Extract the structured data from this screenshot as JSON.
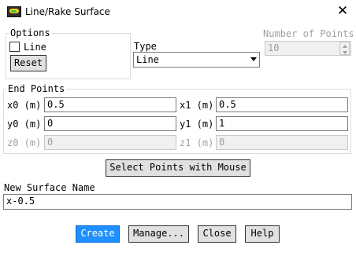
{
  "window": {
    "title": "Line/Rake Surface",
    "close_symbol": "✕"
  },
  "options": {
    "legend": "Options",
    "line_checkbox_label": "Line",
    "line_checked": false,
    "reset_label": "Reset"
  },
  "type": {
    "label": "Type",
    "selected": "Line"
  },
  "number_of_points": {
    "label": "Number of Points",
    "value": "10"
  },
  "end_points": {
    "legend": "End Points",
    "x0": {
      "label": "x0 (m)",
      "value": "0.5"
    },
    "x1": {
      "label": "x1 (m)",
      "value": "0.5"
    },
    "y0": {
      "label": "y0 (m)",
      "value": "0"
    },
    "y1": {
      "label": "y1 (m)",
      "value": "1"
    },
    "z0": {
      "label": "z0 (m)",
      "value": "0"
    },
    "z1": {
      "label": "z1 (m)",
      "value": "0"
    }
  },
  "select_points_label": "Select Points with Mouse",
  "new_surface": {
    "label": "New Surface Name",
    "value": "x-0.5"
  },
  "buttons": {
    "create": "Create",
    "manage": "Manage...",
    "close": "Close",
    "help": "Help"
  },
  "colors": {
    "primary": "#1e90ff",
    "background": "#ffffff",
    "disabled_text": "#a0a0a0"
  }
}
